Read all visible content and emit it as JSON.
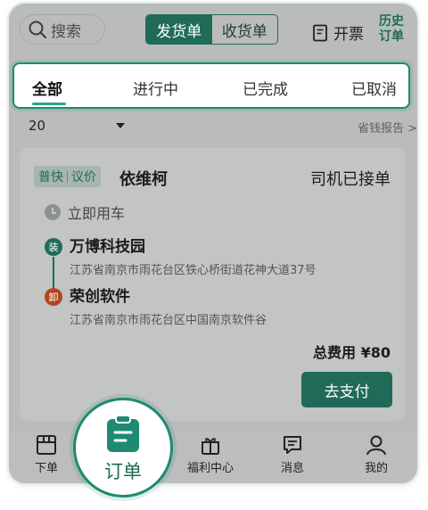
{
  "header": {
    "search_label": "搜索",
    "segment": {
      "active": "发货单",
      "inactive": "收货单"
    },
    "invoice_label": "开票",
    "history_line1": "历史",
    "history_line2": "订单"
  },
  "tabs": [
    "全部",
    "进行中",
    "已完成",
    "已取消"
  ],
  "active_tab": "全部",
  "date_filter": {
    "value": "20",
    "report_link": "省钱报告 >"
  },
  "order": {
    "badge_left": "普快",
    "badge_right": "议价",
    "goods": "依维柯",
    "status": "司机已接单",
    "time": "立即用车",
    "load": {
      "tag": "装",
      "name": "万博科技园",
      "address": "江苏省南京市雨花台区铁心桥街道花神大道37号"
    },
    "unload": {
      "tag": "卸",
      "name": "荣创软件",
      "address": "江苏省南京市雨花台区中国南京软件谷"
    },
    "total": "总费用 ¥80",
    "pay_label": "去支付"
  },
  "nav": {
    "place_order": "下单",
    "orders": "订单",
    "welfare": "福利中心",
    "messages": "消息",
    "mine": "我的"
  },
  "colors": {
    "brand": "#1f6b58",
    "highlight": "#1f8a72",
    "unload": "#b0481f"
  }
}
